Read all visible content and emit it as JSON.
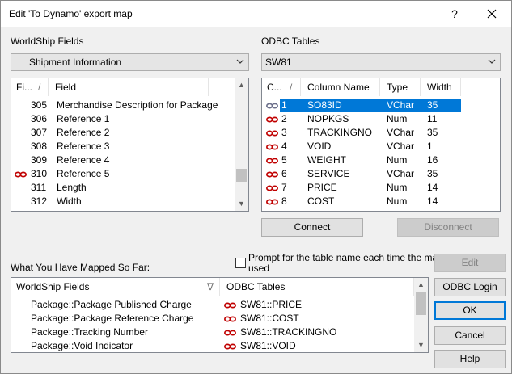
{
  "colors": {
    "selection": "#0078d7",
    "link_icon": "#c00000",
    "link_icon_selected": "#6b6f8a"
  },
  "titlebar": {
    "title": "Edit 'To Dynamo' export map",
    "help_label": "?",
    "close_label": "✕"
  },
  "worldship": {
    "label": "WorldShip Fields",
    "dropdown_value": "Shipment Information",
    "columns": [
      "Fi...",
      "Field"
    ],
    "rows": [
      {
        "num": "305",
        "field": "Merchandise Description for Package",
        "linked": false
      },
      {
        "num": "306",
        "field": "Reference 1",
        "linked": false
      },
      {
        "num": "307",
        "field": "Reference 2",
        "linked": false
      },
      {
        "num": "308",
        "field": "Reference 3",
        "linked": false
      },
      {
        "num": "309",
        "field": "Reference 4",
        "linked": false
      },
      {
        "num": "310",
        "field": "Reference 5",
        "linked": true
      },
      {
        "num": "311",
        "field": "Length",
        "linked": false
      },
      {
        "num": "312",
        "field": "Width",
        "linked": false
      }
    ]
  },
  "odbc": {
    "label": "ODBC Tables",
    "dropdown_value": "SW81",
    "columns": [
      "C...",
      "Column Name",
      "Type",
      "Width"
    ],
    "rows": [
      {
        "num": "1",
        "name": "SO83ID",
        "type": "VChar",
        "width": "35",
        "linked": true,
        "selected": true
      },
      {
        "num": "2",
        "name": "NOPKGS",
        "type": "Num",
        "width": "11",
        "linked": true,
        "selected": false
      },
      {
        "num": "3",
        "name": "TRACKINGNO",
        "type": "VChar",
        "width": "35",
        "linked": true,
        "selected": false
      },
      {
        "num": "4",
        "name": "VOID",
        "type": "VChar",
        "width": "1",
        "linked": true,
        "selected": false
      },
      {
        "num": "5",
        "name": "WEIGHT",
        "type": "Num",
        "width": "16",
        "linked": true,
        "selected": false
      },
      {
        "num": "6",
        "name": "SERVICE",
        "type": "VChar",
        "width": "35",
        "linked": true,
        "selected": false
      },
      {
        "num": "7",
        "name": "PRICE",
        "type": "Num",
        "width": "14",
        "linked": true,
        "selected": false
      },
      {
        "num": "8",
        "name": "COST",
        "type": "Num",
        "width": "14",
        "linked": true,
        "selected": false
      }
    ],
    "connect_label": "Connect",
    "disconnect_label": "Disconnect"
  },
  "mapped": {
    "label": "What You Have Mapped So Far:",
    "prompt_label_line1": "Prompt for the table name each time the map is",
    "prompt_label_line2": "used",
    "prompt_checked": false,
    "columns": [
      "WorldShip Fields",
      "ODBC Tables"
    ],
    "rows": [
      {
        "field": "Package::Package Published Charge",
        "table": "SW81::PRICE"
      },
      {
        "field": "Package::Package Reference Charge",
        "table": "SW81::COST"
      },
      {
        "field": "Package::Tracking Number",
        "table": "SW81::TRACKINGNO"
      },
      {
        "field": "Package::Void Indicator",
        "table": "SW81::VOID"
      }
    ]
  },
  "buttons": {
    "edit": "Edit",
    "odbc_login": "ODBC Login",
    "ok": "OK",
    "cancel": "Cancel",
    "help": "Help"
  }
}
